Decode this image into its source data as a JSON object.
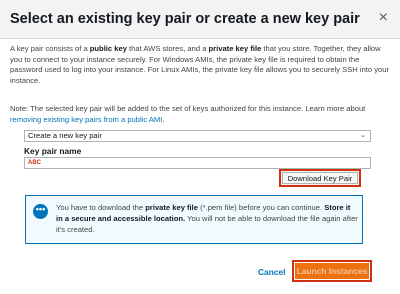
{
  "modal": {
    "title": "Select an existing key pair or create a new key pair",
    "close_label": "×"
  },
  "description": {
    "p1": "A key pair consists of a ",
    "public_key": "public key",
    "p2": " that AWS stores, and a ",
    "private_key": "private key file",
    "p3": " that you store. Together, they allow you to connect to your instance securely. For Windows AMIs, the private key file is required to obtain the password used to log into your instance. For Linux AMIs, the private key file allows you to securely SSH into your instance."
  },
  "note": {
    "text": "Note: The selected key pair will be added to the set of keys authorized for this instance. Learn more about ",
    "link": "removing existing key pairs from a public AMI",
    "end": "."
  },
  "keypair_select": {
    "selected": "Create a new key pair"
  },
  "keypair_name": {
    "label": "Key pair name",
    "value": "ABC"
  },
  "buttons": {
    "download": "Download Key Pair",
    "cancel": "Cancel",
    "launch": "Launch Instances"
  },
  "info": {
    "t1": "You have to download the ",
    "b1": "private key file",
    "t2": " (*.pem file) before you can continue. ",
    "b2": "Store it in a secure and accessible location.",
    "t3": " You will not be able to download the file again after it's created."
  },
  "colors": {
    "accent": "#0073bb",
    "primary_button": "#ec7211",
    "highlight": "#d13212"
  }
}
